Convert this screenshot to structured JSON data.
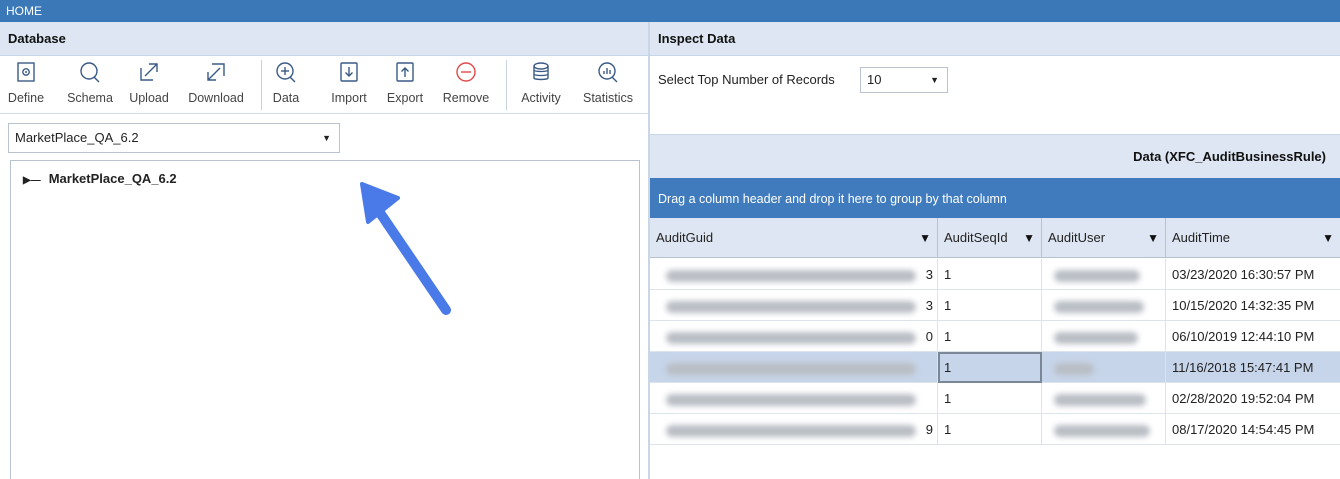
{
  "window": {
    "title": "HOME"
  },
  "database_panel": {
    "title": "Database",
    "toolbar": {
      "define": "Define",
      "schema": "Schema",
      "upload": "Upload",
      "download": "Download",
      "data": "Data",
      "import": "Import",
      "export": "Export",
      "remove": "Remove",
      "activity": "Activity",
      "statistics": "Statistics"
    },
    "selected_database": "MarketPlace_QA_6.2",
    "tree": {
      "root": "MarketPlace_QA_6.2"
    }
  },
  "inspect_panel": {
    "title": "Inspect Data",
    "top_records_label": "Select Top Number of Records",
    "top_records_value": "10",
    "data_title": "Data (XFC_AuditBusinessRule)",
    "group_hint": "Drag a column header and drop it here to group by that column",
    "columns": [
      "AuditGuid",
      "AuditSeqId",
      "AuditUser",
      "AuditTime"
    ],
    "rows": [
      {
        "guid_tail": "3",
        "seq": "1",
        "time": "03/23/2020 16:30:57 PM"
      },
      {
        "guid_tail": "3",
        "seq": "1",
        "time": "10/15/2020 14:32:35 PM"
      },
      {
        "guid_tail": "0",
        "seq": "1",
        "time": "06/10/2019 12:44:10 PM"
      },
      {
        "guid_tail": "",
        "seq": "1",
        "time": "11/16/2018 15:47:41 PM"
      },
      {
        "guid_tail": "",
        "seq": "1",
        "time": "02/28/2020 19:52:04 PM"
      },
      {
        "guid_tail": "9",
        "seq": "1",
        "time": "08/17/2020 14:54:45 PM"
      }
    ]
  },
  "colors": {
    "titlebar": "#3b78b8",
    "header_bg": "#dde6f2",
    "group_bar": "#3f7bbd",
    "accent": "#4a79e8",
    "remove": "#e04a4a"
  }
}
